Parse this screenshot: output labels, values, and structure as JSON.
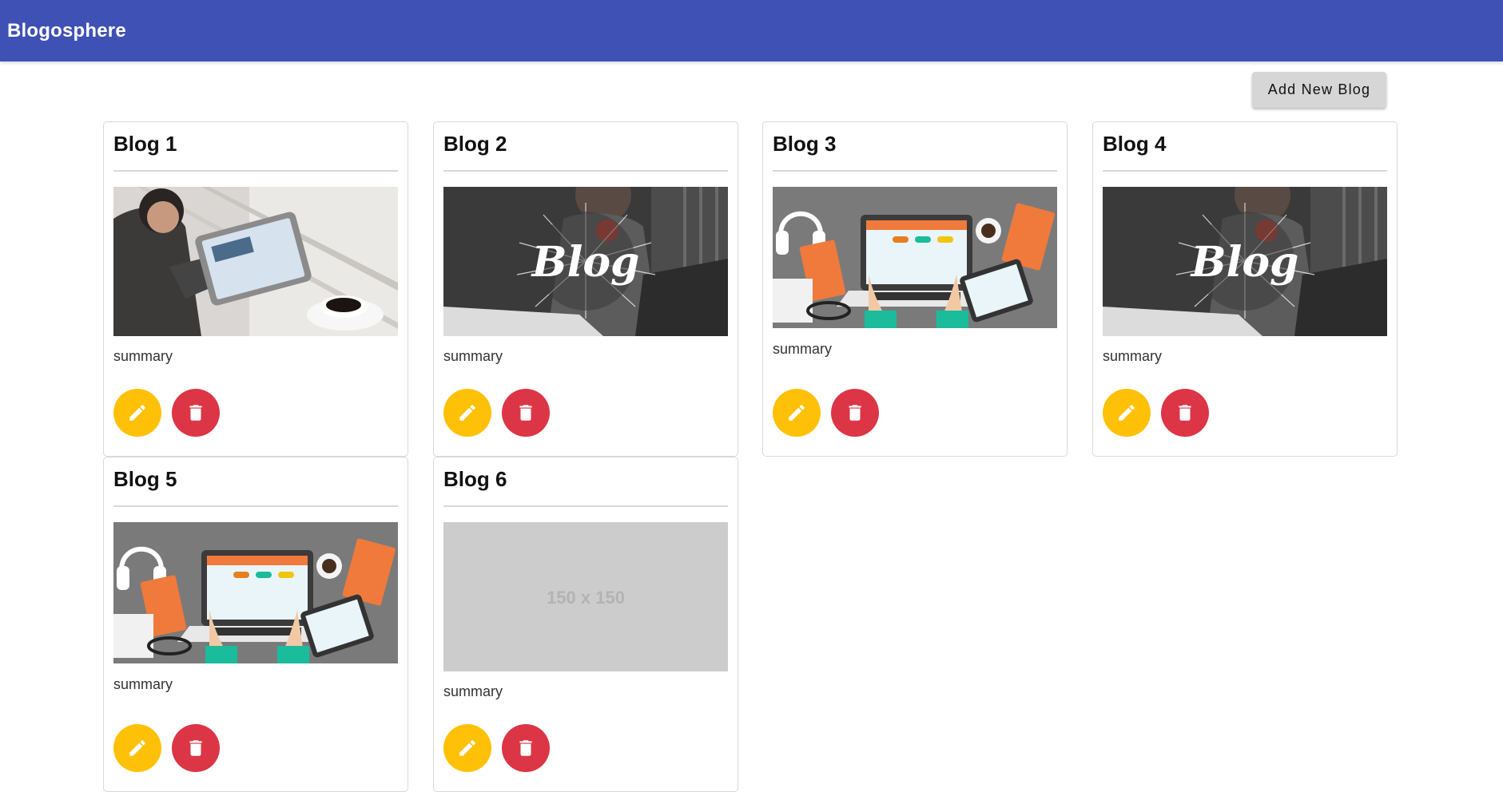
{
  "appbar": {
    "title": "Blogosphere"
  },
  "toolbar": {
    "add_label": "Add New Blog"
  },
  "blogs": [
    {
      "title": "Blog 1",
      "summary": "summary",
      "image": "tablet-coffee-photo"
    },
    {
      "title": "Blog 2",
      "summary": "summary",
      "image": "blog-banner-photo",
      "banner_text": "Blog"
    },
    {
      "title": "Blog 3",
      "summary": "summary",
      "image": "workspace-illustration"
    },
    {
      "title": "Blog 4",
      "summary": "summary",
      "image": "blog-banner-photo",
      "banner_text": "Blog"
    },
    {
      "title": "Blog 5",
      "summary": "summary",
      "image": "workspace-illustration"
    },
    {
      "title": "Blog 6",
      "summary": "summary",
      "image": "placeholder",
      "placeholder_text": "150 x 150"
    }
  ],
  "icons": {
    "edit": "pencil-icon",
    "delete": "trash-icon"
  },
  "colors": {
    "appbar": "#3f51b5",
    "edit_button": "#ffc107",
    "delete_button": "#dc3545",
    "add_button": "#d6d6d6",
    "placeholder_bg": "#cccccc"
  }
}
